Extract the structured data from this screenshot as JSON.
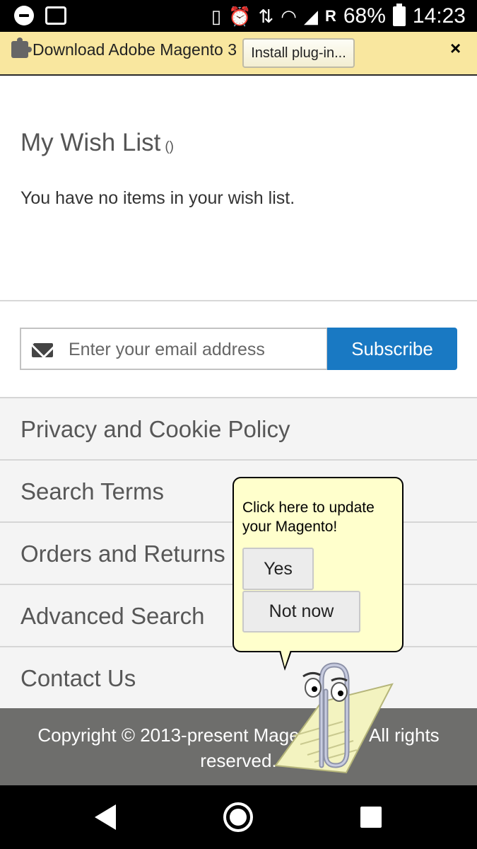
{
  "status_bar": {
    "left_icons": [
      "do-not-disturb-icon",
      "activity-icon"
    ],
    "right_icons": [
      "vibrate-icon",
      "alarm-icon",
      "data-arrows-icon",
      "wifi-icon",
      "signal-icon"
    ],
    "roaming": "R",
    "battery": "68%",
    "time": "14:23"
  },
  "plugin_bar": {
    "message": "Download Adobe Magento 3",
    "install_label": "Install plug-in...",
    "close_label": "×",
    "background": "#f9e79f"
  },
  "wishlist": {
    "title": "My Wish List",
    "count": "()",
    "empty_message": "You have no items in your wish list."
  },
  "newsletter": {
    "placeholder": "Enter your email address",
    "subscribe_label": "Subscribe",
    "accent": "#1979c3"
  },
  "footer_links": [
    {
      "label": "Privacy and Cookie Policy"
    },
    {
      "label": "Search Terms"
    },
    {
      "label": "Orders and Returns"
    },
    {
      "label": "Advanced Search"
    },
    {
      "label": "Contact Us"
    }
  ],
  "copyright": "Copyright © 2013-present Magento, Inc. All rights reserved.",
  "clippy": {
    "message": "Click here to update your Magento!",
    "yes_label": "Yes",
    "not_now_label": "Not now"
  },
  "nav_bar": {
    "icons": [
      "back-icon",
      "home-icon",
      "recents-icon"
    ]
  }
}
